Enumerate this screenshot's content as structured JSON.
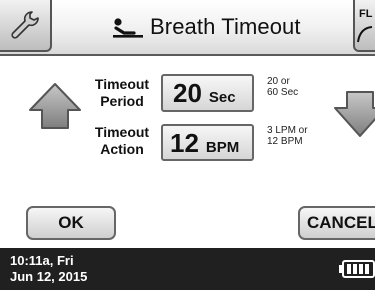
{
  "header": {
    "title": "Breath Timeout",
    "right_button_label": "FL"
  },
  "icons": {
    "settings": "wrench-icon",
    "title": "reclining-person-icon",
    "increase": "arrow-up-icon",
    "decrease": "arrow-down-icon",
    "battery": "battery-icon"
  },
  "settings": {
    "period": {
      "label_line1": "Timeout",
      "label_line2": "Period",
      "value": "20",
      "unit": "Sec",
      "hint_line1": "20 or",
      "hint_line2": "60 Sec"
    },
    "action": {
      "label_line1": "Timeout",
      "label_line2": "Action",
      "value": "12",
      "unit": "BPM",
      "hint_line1": "3 LPM or",
      "hint_line2": "12 BPM"
    }
  },
  "buttons": {
    "ok": "OK",
    "cancel": "CANCEL"
  },
  "footer": {
    "time": "10:11a, Fri",
    "date": "Jun 12, 2015"
  }
}
